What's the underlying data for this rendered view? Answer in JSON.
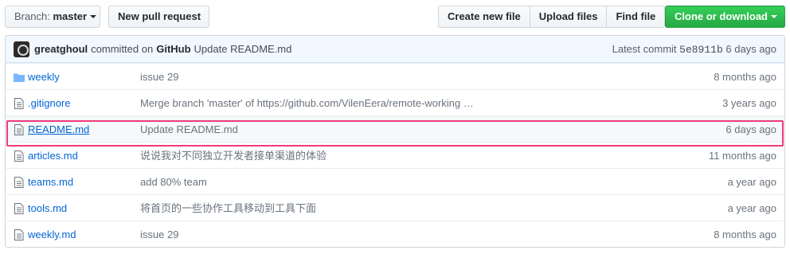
{
  "toolbar": {
    "branch_prefix": "Branch:",
    "branch_name": "master",
    "new_pr": "New pull request",
    "create_file": "Create new file",
    "upload_files": "Upload files",
    "find_file": "Find file",
    "clone": "Clone or download"
  },
  "commit": {
    "author": "greatghoul",
    "committed_on": "committed on",
    "platform": "GitHub",
    "message": "Update README.md",
    "latest_label": "Latest commit",
    "sha": "5e8911b",
    "age": "6 days ago"
  },
  "files": [
    {
      "type": "folder-icon",
      "name": "weekly",
      "message": "issue 29",
      "age": "8 months ago"
    },
    {
      "type": "file-icon",
      "name": ".gitignore",
      "message": "Merge branch 'master' of https://github.com/VilenEera/remote-working …",
      "age": "3 years ago"
    },
    {
      "type": "file-icon",
      "name": "README.md",
      "message": "Update README.md",
      "age": "6 days ago"
    },
    {
      "type": "file-icon",
      "name": "articles.md",
      "message": "说说我对不同独立开发者接单渠道的体验",
      "age": "11 months ago"
    },
    {
      "type": "file-icon",
      "name": "teams.md",
      "message": "add 80% team",
      "age": "a year ago"
    },
    {
      "type": "file-icon",
      "name": "tools.md",
      "message": "将首页的一些协作工具移动到工具下面",
      "age": "a year ago"
    },
    {
      "type": "file-icon",
      "name": "weekly.md",
      "message": "issue 29",
      "age": "8 months ago"
    }
  ],
  "colors": {
    "link": "#0366d6",
    "highlight_border": "#ee3b7d",
    "clone_button": "#28a745",
    "commit_bar": "#f1f8ff"
  }
}
